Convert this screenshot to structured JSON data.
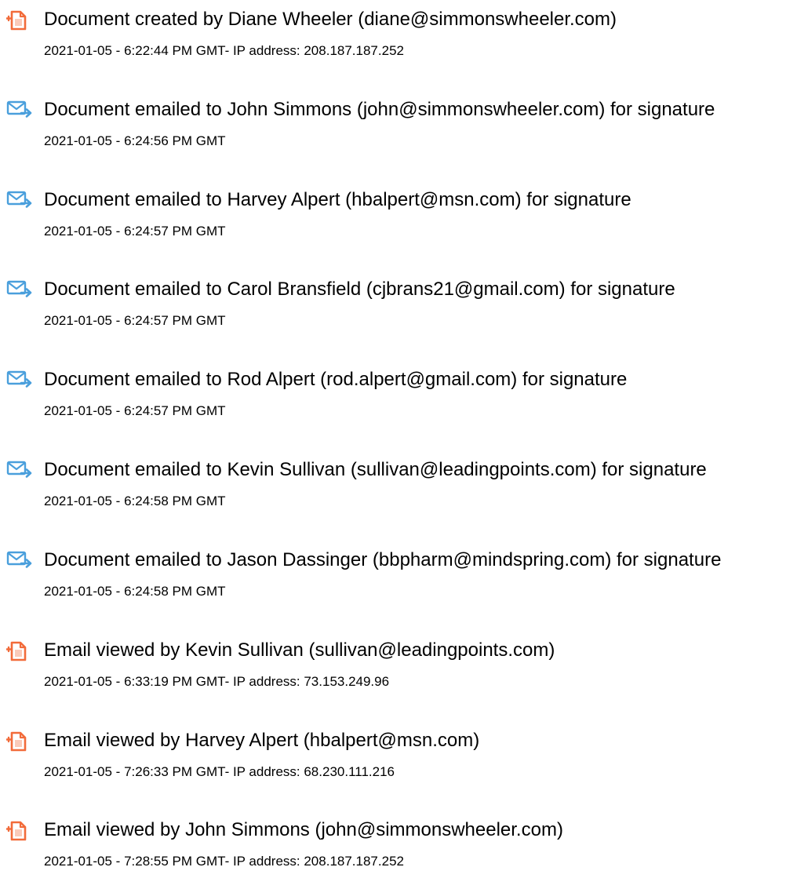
{
  "colors": {
    "doc_icon": "#f26b3a",
    "mail_icon": "#4a9fdc",
    "text": "#000000"
  },
  "entries": [
    {
      "icon": "document-icon",
      "title": "Document created by Diane Wheeler (diane@simmonswheeler.com)",
      "meta": "2021-01-05 - 6:22:44 PM GMT- IP address: 208.187.187.252"
    },
    {
      "icon": "email-sent-icon",
      "title": "Document emailed to John Simmons (john@simmonswheeler.com) for signature",
      "meta": "2021-01-05 - 6:24:56 PM GMT"
    },
    {
      "icon": "email-sent-icon",
      "title": "Document emailed to Harvey Alpert (hbalpert@msn.com) for signature",
      "meta": "2021-01-05 - 6:24:57 PM GMT"
    },
    {
      "icon": "email-sent-icon",
      "title": "Document emailed to Carol Bransfield (cjbrans21@gmail.com) for signature",
      "meta": "2021-01-05 - 6:24:57 PM GMT"
    },
    {
      "icon": "email-sent-icon",
      "title": "Document emailed to Rod Alpert (rod.alpert@gmail.com) for signature",
      "meta": "2021-01-05 - 6:24:57 PM GMT"
    },
    {
      "icon": "email-sent-icon",
      "title": "Document emailed to Kevin Sullivan (sullivan@leadingpoints.com) for signature",
      "meta": "2021-01-05 - 6:24:58 PM GMT"
    },
    {
      "icon": "email-sent-icon",
      "title": "Document emailed to Jason Dassinger (bbpharm@mindspring.com) for signature",
      "meta": "2021-01-05 - 6:24:58 PM GMT"
    },
    {
      "icon": "document-icon",
      "title": "Email viewed by Kevin Sullivan (sullivan@leadingpoints.com)",
      "meta": "2021-01-05 - 6:33:19 PM GMT- IP address: 73.153.249.96"
    },
    {
      "icon": "document-icon",
      "title": "Email viewed by Harvey Alpert (hbalpert@msn.com)",
      "meta": "2021-01-05 - 7:26:33 PM GMT- IP address: 68.230.111.216"
    },
    {
      "icon": "document-icon",
      "title": "Email viewed by John Simmons (john@simmonswheeler.com)",
      "meta": "2021-01-05 - 7:28:55 PM GMT- IP address: 208.187.187.252"
    }
  ]
}
